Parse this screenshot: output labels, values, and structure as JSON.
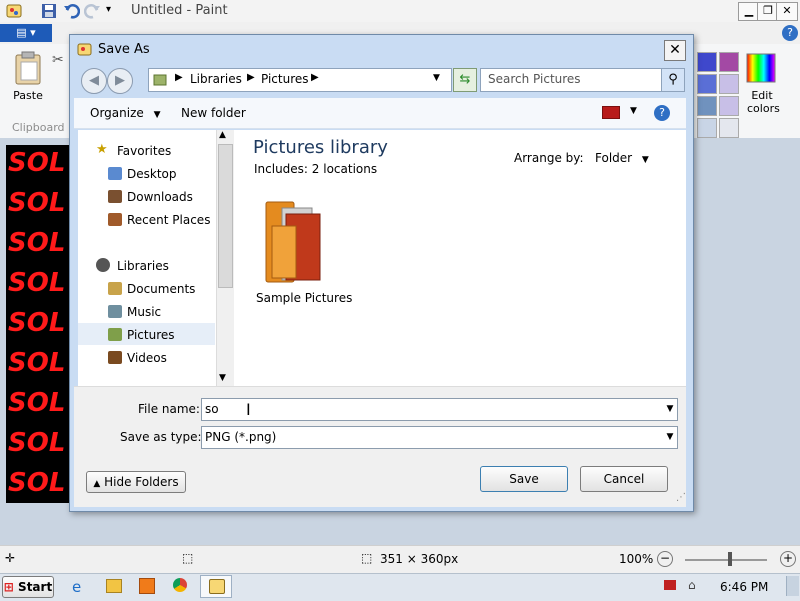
{
  "app": {
    "title": "Untitled - Paint",
    "file_tab": "▤ ▾",
    "clipboard": {
      "paste_label": "Paste",
      "group_label": "Clipboard"
    },
    "edit_colors_line1": "Edit",
    "edit_colors_line2": "colors",
    "image_text": "SOL",
    "palette": [
      "#3f48cc",
      "#a349a4",
      "#5a6fd6",
      "#c8bfe7",
      "#7092be",
      "#c8bfe7",
      "#c9d5e6",
      "#e4e7ee"
    ]
  },
  "dialog": {
    "title": "Save As",
    "address": {
      "segments": [
        "Libraries",
        "Pictures"
      ]
    },
    "search": {
      "placeholder": "Search Pictures"
    },
    "toolbar": {
      "organize_label": "Organize",
      "new_folder_label": "New folder"
    },
    "nav": {
      "favorites": {
        "label": "Favorites",
        "items": [
          "Desktop",
          "Downloads",
          "Recent Places"
        ]
      },
      "libraries": {
        "label": "Libraries",
        "items": [
          "Documents",
          "Music",
          "Pictures",
          "Videos"
        ]
      },
      "selected": "Pictures"
    },
    "library": {
      "title": "Pictures library",
      "includes": "Includes:  2 locations",
      "arrange_label": "Arrange by:",
      "arrange_value": "Folder",
      "items": [
        {
          "label": "Sample Pictures"
        }
      ]
    },
    "file_name": {
      "label": "File name:",
      "value": "so"
    },
    "save_type": {
      "label": "Save as type:",
      "value": "PNG (*.png)"
    },
    "hide_folders_label": "Hide Folders",
    "save_label": "Save",
    "cancel_label": "Cancel"
  },
  "status": {
    "dimensions": "351 × 360px",
    "zoom": "100%"
  },
  "taskbar": {
    "start_label": "Start",
    "clock": "6:46 PM"
  }
}
